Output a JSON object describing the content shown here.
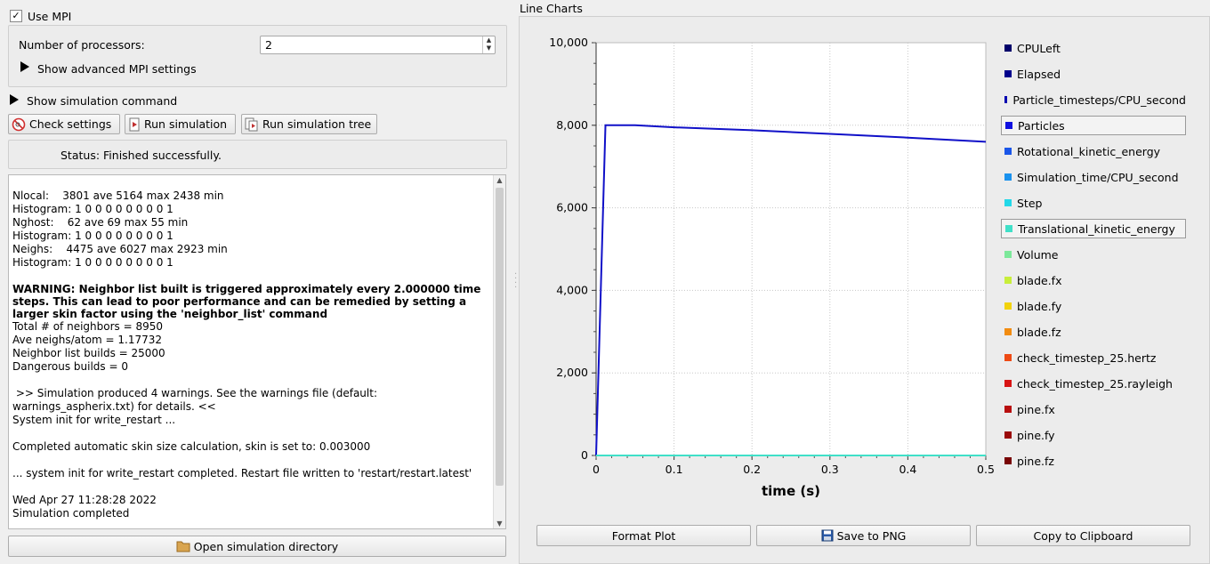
{
  "mpi": {
    "use_mpi_label": "Use MPI",
    "use_mpi_checked": true,
    "processors_label": "Number of processors:",
    "processors_value": "2",
    "advanced_label": "Show advanced MPI settings"
  },
  "sim": {
    "show_command_label": "Show simulation command",
    "check_settings": "Check settings",
    "run_simulation": "Run simulation",
    "run_simulation_tree": "Run simulation tree",
    "status": "Status: Finished successfully.",
    "open_directory": "Open simulation directory"
  },
  "log": {
    "lines": [
      "",
      "Nlocal:    3801 ave 5164 max 2438 min",
      "Histogram: 1 0 0 0 0 0 0 0 0 1",
      "Nghost:    62 ave 69 max 55 min",
      "Histogram: 1 0 0 0 0 0 0 0 0 1",
      "Neighs:    4475 ave 6027 max 2923 min",
      "Histogram: 1 0 0 0 0 0 0 0 0 1",
      ""
    ],
    "warning": "WARNING: Neighbor list built is triggered approximately every 2.000000 time steps. This can lead to poor performance and can be remedied by setting a larger skin factor using the 'neighbor_list' command",
    "lines2": [
      "Total # of neighbors = 8950",
      "Ave neighs/atom = 1.17732",
      "Neighbor list builds = 25000",
      "Dangerous builds = 0",
      "",
      " >> Simulation produced 4 warnings. See the warnings file (default:",
      "warnings_aspherix.txt) for details. <<",
      "System init for write_restart ...",
      "",
      "Completed automatic skin size calculation, skin is set to: 0.003000",
      "",
      "... system init for write_restart completed. Restart file written to 'restart/restart.latest'",
      "",
      "Wed Apr 27 11:28:28 2022",
      "Simulation completed"
    ]
  },
  "charts": {
    "panel_title": "Line Charts",
    "format_plot": "Format Plot",
    "save_png": "Save to PNG",
    "copy_clipboard": "Copy to Clipboard"
  },
  "chart_data": {
    "type": "line",
    "xlabel": "time (s)",
    "ylabel": "",
    "xlim": [
      0,
      0.5
    ],
    "ylim": [
      0,
      10000
    ],
    "x_ticks": [
      "0",
      "0.1",
      "0.2",
      "0.3",
      "0.4",
      "0.5"
    ],
    "y_ticks": [
      "0",
      "2,000",
      "4,000",
      "6,000",
      "8,000",
      "10,000"
    ],
    "grid": true,
    "legend_position": "right",
    "series": [
      {
        "name": "Particles",
        "color": "#1010c8",
        "x": [
          0,
          0.012,
          0.05,
          0.1,
          0.2,
          0.3,
          0.4,
          0.5
        ],
        "y": [
          0,
          8000,
          8000,
          7950,
          7880,
          7790,
          7700,
          7600
        ]
      },
      {
        "name": "Translational_kinetic_energy",
        "color": "#40e0c8",
        "x": [
          0,
          0.5
        ],
        "y": [
          0,
          0
        ]
      }
    ],
    "legend": [
      {
        "name": "CPULeft",
        "color": "#00006a",
        "selected": false
      },
      {
        "name": "Elapsed",
        "color": "#00008c",
        "selected": false
      },
      {
        "name": "Particle_timesteps/CPU_second",
        "color": "#0000b0",
        "selected": false
      },
      {
        "name": "Particles",
        "color": "#1010e0",
        "selected": true
      },
      {
        "name": "Rotational_kinetic_energy",
        "color": "#1a56e8",
        "selected": false
      },
      {
        "name": "Simulation_time/CPU_second",
        "color": "#1a92ee",
        "selected": false
      },
      {
        "name": "Step",
        "color": "#22d8e8",
        "selected": false
      },
      {
        "name": "Translational_kinetic_energy",
        "color": "#40e0c8",
        "selected": true
      },
      {
        "name": "Volume",
        "color": "#7ce89a",
        "selected": false
      },
      {
        "name": "blade.fx",
        "color": "#c8ee3a",
        "selected": false
      },
      {
        "name": "blade.fy",
        "color": "#f2d20c",
        "selected": false
      },
      {
        "name": "blade.fz",
        "color": "#f28c10",
        "selected": false
      },
      {
        "name": "check_timestep_25.hertz",
        "color": "#ee4a14",
        "selected": false
      },
      {
        "name": "check_timestep_25.rayleigh",
        "color": "#d81414",
        "selected": false
      },
      {
        "name": "pine.fx",
        "color": "#b80f0f",
        "selected": false
      },
      {
        "name": "pine.fy",
        "color": "#9a0a0a",
        "selected": false
      },
      {
        "name": "pine.fz",
        "color": "#780404",
        "selected": false
      }
    ]
  }
}
